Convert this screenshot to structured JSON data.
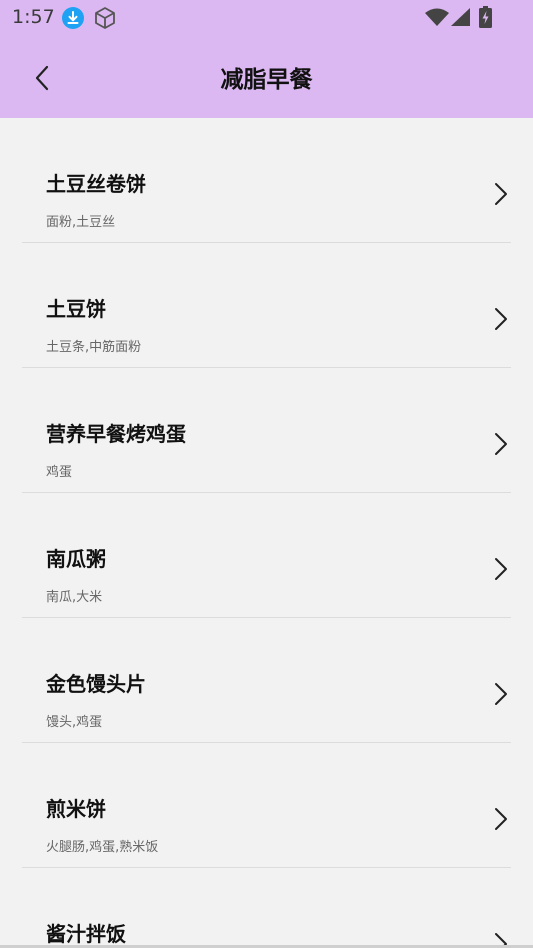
{
  "status_bar": {
    "time": "1:57",
    "icons": [
      "download-icon",
      "box-icon",
      "wifi-icon",
      "signal-icon",
      "battery-icon"
    ]
  },
  "header": {
    "title": "减脂早餐",
    "background_color": "#dbb8f2"
  },
  "recipes": [
    {
      "name": "土豆丝卷饼",
      "ingredients": "面粉,土豆丝"
    },
    {
      "name": "土豆饼",
      "ingredients": "土豆条,中筋面粉"
    },
    {
      "name": "营养早餐烤鸡蛋",
      "ingredients": "鸡蛋"
    },
    {
      "name": "南瓜粥",
      "ingredients": "南瓜,大米"
    },
    {
      "name": "金色馒头片",
      "ingredients": "馒头,鸡蛋"
    },
    {
      "name": "煎米饼",
      "ingredients": "火腿肠,鸡蛋,熟米饭"
    },
    {
      "name": "酱汁拌饭",
      "ingredients": ""
    }
  ]
}
